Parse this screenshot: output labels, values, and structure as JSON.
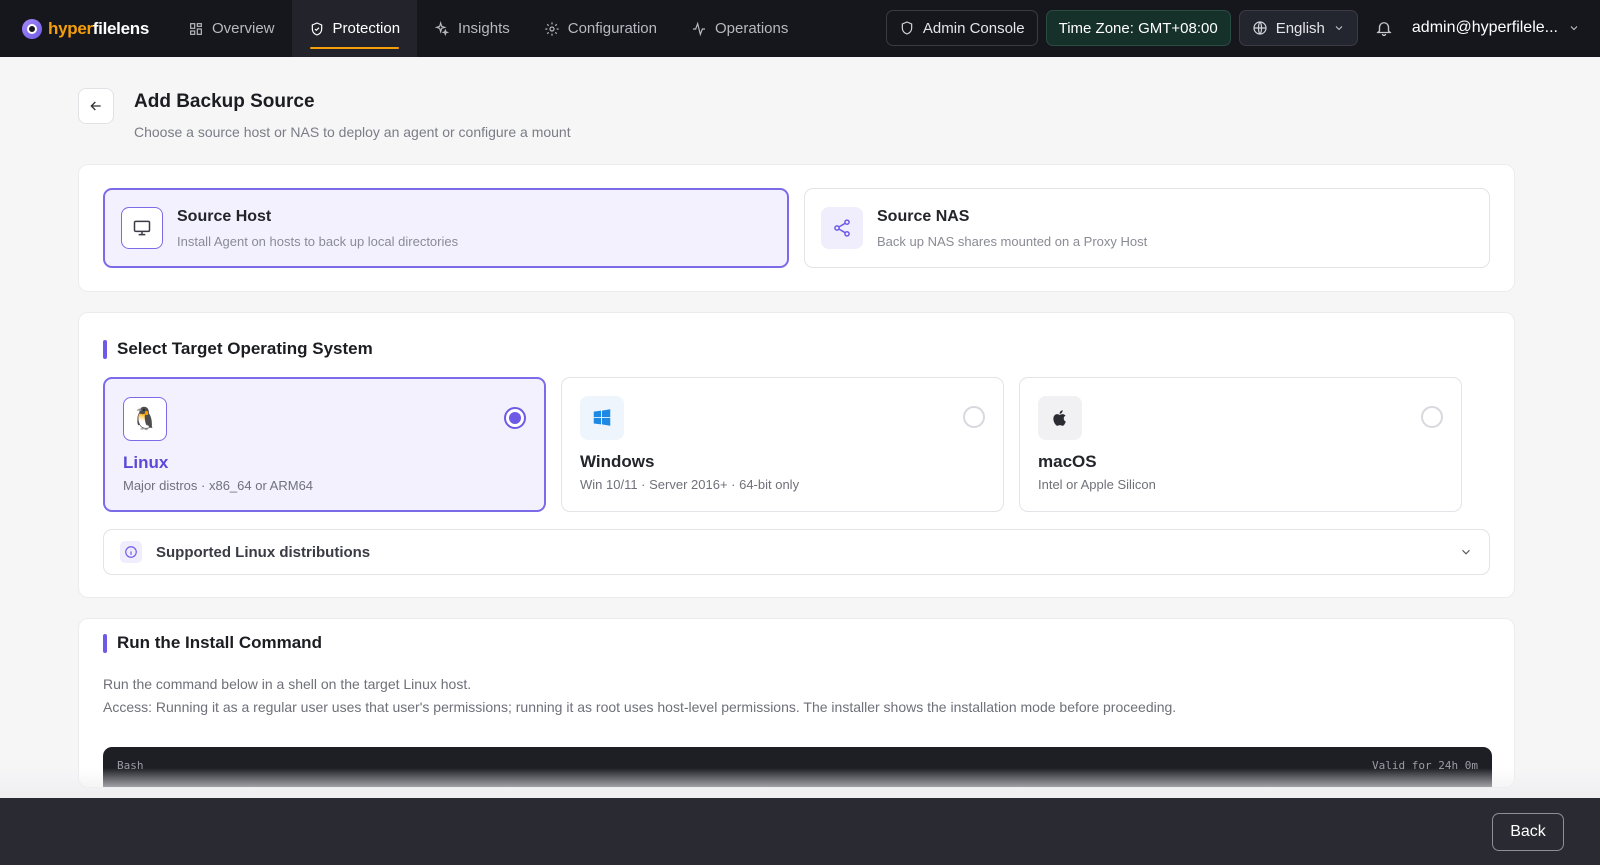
{
  "app": {
    "logo_part1": "hyper",
    "logo_part2": "filelens"
  },
  "nav": {
    "items": [
      {
        "label": "Overview",
        "icon": "grid-icon"
      },
      {
        "label": "Protection",
        "icon": "shield-icon",
        "active": true
      },
      {
        "label": "Insights",
        "icon": "sparkles-icon"
      },
      {
        "label": "Configuration",
        "icon": "gear-icon"
      },
      {
        "label": "Operations",
        "icon": "activity-icon"
      }
    ],
    "admin_console": "Admin Console",
    "timezone": "Time Zone: GMT+08:00",
    "language": "English",
    "user": "admin@hyperfilele..."
  },
  "page": {
    "title": "Add Backup Source",
    "subtitle": "Choose a source host or NAS to deploy an agent or configure a mount"
  },
  "sources": [
    {
      "title": "Source Host",
      "desc": "Install Agent on hosts to back up local directories",
      "selected": true
    },
    {
      "title": "Source NAS",
      "desc": "Back up NAS shares mounted on a Proxy Host",
      "selected": false
    }
  ],
  "os_section": {
    "title": "Select Target Operating System",
    "options": [
      {
        "name": "Linux",
        "desc": "Major distros · x86_64 or ARM64",
        "selected": true
      },
      {
        "name": "Windows",
        "desc": "Win 10/11 · Server 2016+ · 64-bit only",
        "selected": false
      },
      {
        "name": "macOS",
        "desc": "Intel or Apple Silicon",
        "selected": false
      }
    ],
    "distributions_label": "Supported Linux distributions"
  },
  "install_section": {
    "title": "Run the Install Command",
    "line1": "Run the command below in a shell on the target Linux host.",
    "line2": "Access: Running it as a regular user uses that user's permissions; running it as root uses host-level permissions. The installer shows the installation mode before proceeding.",
    "code_lang": "Bash",
    "code_valid": "Valid for 24h 0m"
  },
  "footer": {
    "back_label": "Back"
  },
  "colors": {
    "accent": "#6d5ae6",
    "brand_orange": "#f59e0b",
    "nav_bg": "#16171c"
  }
}
